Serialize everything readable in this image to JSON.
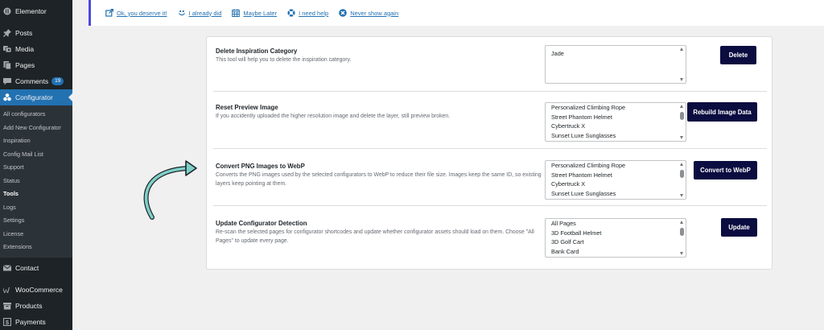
{
  "sidebar": {
    "top": {
      "label": "Elementor",
      "icon": "elementor-icon"
    },
    "items": [
      {
        "label": "Posts",
        "icon": "pin-icon"
      },
      {
        "label": "Media",
        "icon": "media-icon"
      },
      {
        "label": "Pages",
        "icon": "pages-icon"
      },
      {
        "label": "Comments",
        "icon": "comment-icon",
        "badge": "19"
      },
      {
        "label": "Configurator",
        "icon": "configurator-icon"
      }
    ],
    "submenu": [
      "All configurators",
      "Add New Configurator",
      "Inspiration",
      "Config Mail List",
      "Support",
      "Status",
      "Tools",
      "Logs",
      "Settings",
      "License",
      "Extensions"
    ],
    "bottom": [
      {
        "label": "Contact",
        "icon": "mail-icon"
      },
      {
        "label": "WooCommerce",
        "icon": "woocommerce-icon"
      },
      {
        "label": "Products",
        "icon": "archive-icon"
      },
      {
        "label": "Payments",
        "icon": "dollar-icon"
      }
    ]
  },
  "notice": {
    "links": [
      {
        "label": "Ok, you deserve it!",
        "icon": "external-link-icon"
      },
      {
        "label": "I already did",
        "icon": "smiley-icon"
      },
      {
        "label": "Maybe Later",
        "icon": "calendar-icon"
      },
      {
        "label": "I need help",
        "icon": "sos-icon"
      },
      {
        "label": "Never show again",
        "icon": "dismiss-icon"
      }
    ]
  },
  "tools": {
    "delete_category": {
      "title": "Delete Inspiration Category",
      "desc": "This tool will help you to delete the inspiration category.",
      "options": [
        "Jade"
      ],
      "button": "Delete"
    },
    "reset_preview": {
      "title": "Reset Preview Image",
      "desc": "If you accidently uploaded the higher resolution image and delete the layer, still preview broken.",
      "options": [
        "Personalized Climbing Rope",
        "Street Phantom Helmet",
        "Cybertruck X",
        "Sunset Luxe Sunglasses"
      ],
      "button": "Rebuild Image Data"
    },
    "convert_webp": {
      "title": "Convert PNG Images to WebP",
      "desc": "Converts the PNG images used by the selected configurators to WebP to reduce their file size. Images keep the same ID, so existing layers keep pointing at them.",
      "options": [
        "Personalized Climbing Rope",
        "Street Phantom Helmet",
        "Cybertruck X",
        "Sunset Luxe Sunglasses"
      ],
      "button": "Convert to WebP"
    },
    "update_detection": {
      "title": "Update Configurator Detection",
      "desc": "Re-scan the selected pages for configurator shortcodes and update whether configurator assets should load on them. Choose \"All Pages\" to update every page.",
      "options": [
        "All Pages",
        "3D Football Helmet",
        "3D Golf Cart",
        "Bank Card"
      ],
      "button": "Update"
    }
  },
  "colors": {
    "sidebar_bg": "#1d2327",
    "active_menu": "#2271b1",
    "button_bg": "#0b0c40",
    "arrow": "#7ecfc8",
    "notice_border": "#4f46e5"
  }
}
